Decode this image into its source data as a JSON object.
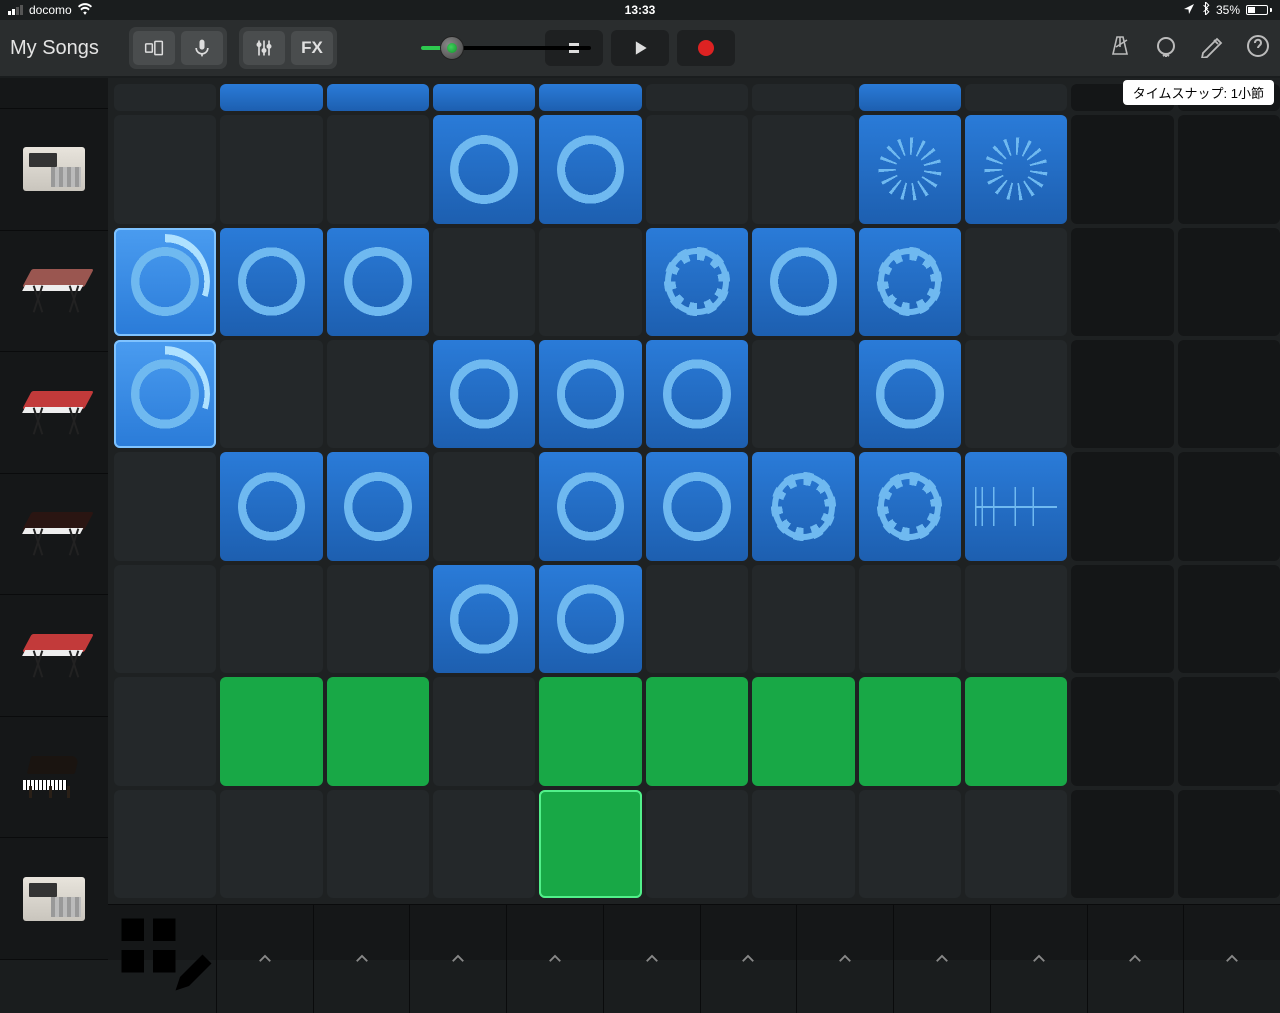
{
  "status": {
    "carrier": "docomo",
    "time": "13:33",
    "battery_pct": "35%"
  },
  "toolbar": {
    "title": "My Songs",
    "fx_label": "FX"
  },
  "snap_badge": "タイムスナップ: 1小節",
  "tracks": [
    {
      "id": "track-partial",
      "instrument": "drum-machine"
    },
    {
      "id": "track-1",
      "instrument": "drum-machine"
    },
    {
      "id": "track-2",
      "instrument": "keyboard",
      "color": "#9a5650"
    },
    {
      "id": "track-3",
      "instrument": "keyboard",
      "color": "#c23a3a"
    },
    {
      "id": "track-4",
      "instrument": "keyboard",
      "color": "#2a1512"
    },
    {
      "id": "track-5",
      "instrument": "keyboard",
      "color": "#c23a3a"
    },
    {
      "id": "track-6",
      "instrument": "piano"
    },
    {
      "id": "track-7",
      "instrument": "drum-machine"
    }
  ],
  "grid": {
    "cols": 11,
    "rows": 8,
    "cells": [
      {
        "r": 0,
        "c": 1,
        "type": "blue",
        "shape": ""
      },
      {
        "r": 0,
        "c": 2,
        "type": "blue",
        "shape": ""
      },
      {
        "r": 0,
        "c": 3,
        "type": "blue",
        "shape": ""
      },
      {
        "r": 0,
        "c": 4,
        "type": "blue",
        "shape": ""
      },
      {
        "r": 0,
        "c": 7,
        "type": "blue",
        "shape": ""
      },
      {
        "r": 1,
        "c": 3,
        "type": "blue",
        "shape": "ring"
      },
      {
        "r": 1,
        "c": 4,
        "type": "blue",
        "shape": "ring"
      },
      {
        "r": 1,
        "c": 7,
        "type": "blue",
        "shape": "burst"
      },
      {
        "r": 1,
        "c": 8,
        "type": "blue",
        "shape": "burst"
      },
      {
        "r": 2,
        "c": 0,
        "type": "blue",
        "shape": "ring",
        "playing": true
      },
      {
        "r": 2,
        "c": 1,
        "type": "blue",
        "shape": "ring"
      },
      {
        "r": 2,
        "c": 2,
        "type": "blue",
        "shape": "ring"
      },
      {
        "r": 2,
        "c": 5,
        "type": "blue",
        "shape": "spike"
      },
      {
        "r": 2,
        "c": 6,
        "type": "blue",
        "shape": "ring"
      },
      {
        "r": 2,
        "c": 7,
        "type": "blue",
        "shape": "spike"
      },
      {
        "r": 3,
        "c": 0,
        "type": "blue",
        "shape": "ring",
        "playing": true
      },
      {
        "r": 3,
        "c": 3,
        "type": "blue",
        "shape": "ring"
      },
      {
        "r": 3,
        "c": 4,
        "type": "blue",
        "shape": "ring"
      },
      {
        "r": 3,
        "c": 5,
        "type": "blue",
        "shape": "ring"
      },
      {
        "r": 3,
        "c": 7,
        "type": "blue",
        "shape": "ring"
      },
      {
        "r": 4,
        "c": 1,
        "type": "blue",
        "shape": "ring"
      },
      {
        "r": 4,
        "c": 2,
        "type": "blue",
        "shape": "ring"
      },
      {
        "r": 4,
        "c": 4,
        "type": "blue",
        "shape": "ring"
      },
      {
        "r": 4,
        "c": 5,
        "type": "blue",
        "shape": "ring"
      },
      {
        "r": 4,
        "c": 6,
        "type": "blue",
        "shape": "spike"
      },
      {
        "r": 4,
        "c": 7,
        "type": "blue",
        "shape": "spike"
      },
      {
        "r": 4,
        "c": 8,
        "type": "blue",
        "shape": "wave"
      },
      {
        "r": 5,
        "c": 3,
        "type": "blue",
        "shape": "ring"
      },
      {
        "r": 5,
        "c": 4,
        "type": "blue",
        "shape": "ring"
      },
      {
        "r": 6,
        "c": 1,
        "type": "green"
      },
      {
        "r": 6,
        "c": 2,
        "type": "green"
      },
      {
        "r": 6,
        "c": 4,
        "type": "green"
      },
      {
        "r": 6,
        "c": 5,
        "type": "green"
      },
      {
        "r": 6,
        "c": 6,
        "type": "green"
      },
      {
        "r": 6,
        "c": 7,
        "type": "green"
      },
      {
        "r": 6,
        "c": 8,
        "type": "green"
      },
      {
        "r": 7,
        "c": 4,
        "type": "green",
        "outlined": true
      }
    ]
  }
}
